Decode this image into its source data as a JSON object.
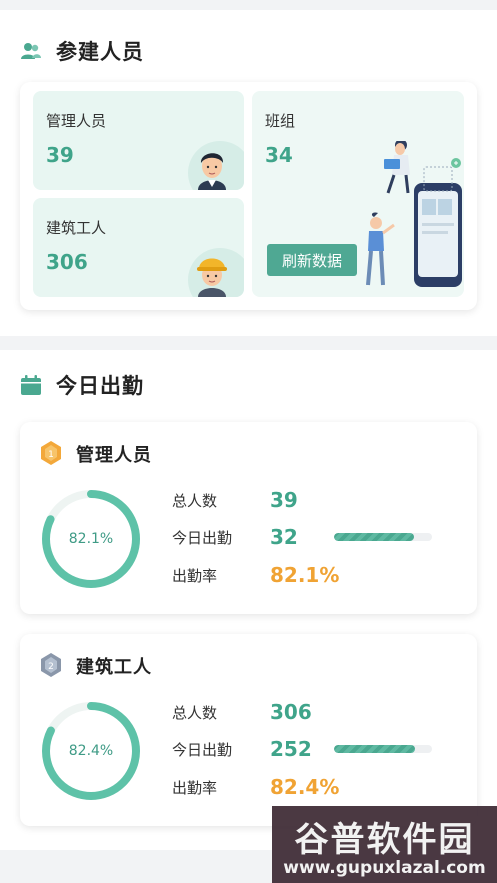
{
  "personnel": {
    "title": "参建人员",
    "managers": {
      "label": "管理人员",
      "value": "39"
    },
    "workers": {
      "label": "建筑工人",
      "value": "306"
    },
    "teams": {
      "label": "班组",
      "value": "34"
    },
    "refresh_label": "刷新数据"
  },
  "attendance": {
    "title": "今日出勤",
    "cards": [
      {
        "title": "管理人员",
        "medal": "1",
        "ring_label": "82.1%",
        "rate_fraction": 0.821,
        "total_label": "总人数",
        "total": "39",
        "present_label": "今日出勤",
        "present": "32",
        "rate_label": "出勤率",
        "rate": "82.1%"
      },
      {
        "title": "建筑工人",
        "medal": "2",
        "ring_label": "82.4%",
        "rate_fraction": 0.824,
        "total_label": "总人数",
        "total": "306",
        "present_label": "今日出勤",
        "present": "252",
        "rate_label": "出勤率",
        "rate": "82.4%"
      }
    ]
  },
  "watermark": {
    "line1": "谷普软件园",
    "line2": "www.gupuxlazal.com"
  },
  "colors": {
    "accent": "#3fa48a",
    "tile_bg": "#e8f6f2",
    "rate": "#f0a334",
    "button": "#4fa893"
  },
  "icons": {
    "personnel": "people-icon",
    "attendance": "calendar-icon",
    "medal1": "gold-medal-icon",
    "medal2": "silver-medal-icon"
  }
}
